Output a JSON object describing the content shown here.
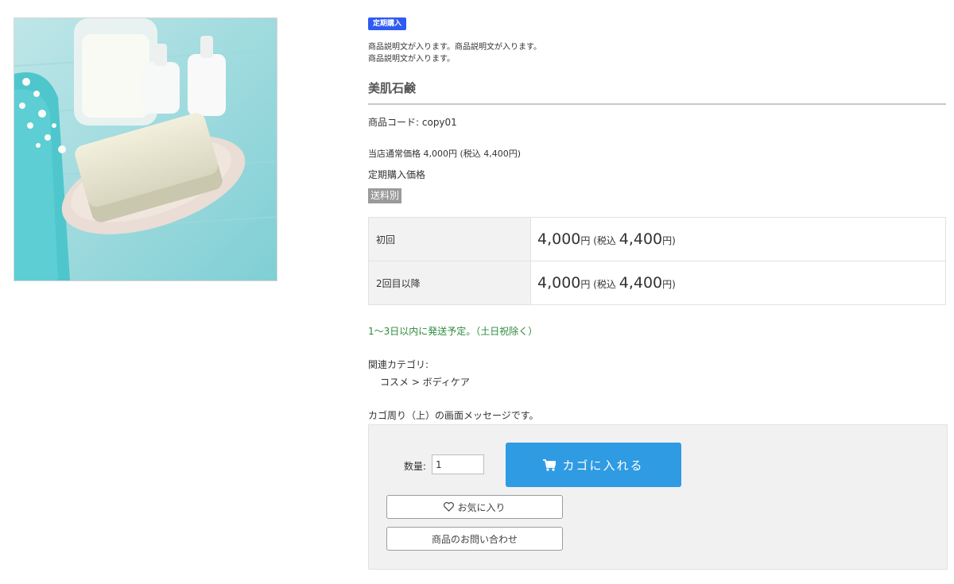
{
  "colors": {
    "badge_bg": "#2f5bf2",
    "cart_button_bg": "#2f9be3",
    "shipping_note": "#2c8a3c",
    "shipping_tag_bg": "#9a9a9a"
  },
  "product": {
    "image_alt": "soap-product-photo",
    "badge": "定期購入",
    "description_line1": "商品説明文が入ります。商品説明文が入ります。",
    "description_line2": "商品説明文が入ります。",
    "name": "美肌石鹸",
    "code_label": "商品コード:",
    "code_value": "copy01",
    "normal_price": "当店通常価格 4,000円 (税込 4,400円)",
    "subscription_label": "定期購入価格",
    "shipping_tag": "送料別"
  },
  "price_rows": [
    {
      "label": "初回",
      "price": "4,000",
      "yen": "円",
      "tax_open": " (税込 ",
      "tax_price": "4,400",
      "tax_close": "円)"
    },
    {
      "label": "2回目以降",
      "price": "4,000",
      "yen": "円",
      "tax_open": " (税込 ",
      "tax_price": "4,400",
      "tax_close": "円)"
    }
  ],
  "shipping_note": "1〜3日以内に発送予定。（土日祝除く）",
  "category": {
    "label": "関連カテゴリ:",
    "path": "コスメ > ボディケア"
  },
  "cart": {
    "message": "カゴ周り（上）の画面メッセージです。",
    "qty_label": "数量:",
    "qty_value": "1",
    "add_to_cart_label": "カゴに入れる",
    "icon": "cart-icon",
    "favorite_label": "お気に入り",
    "favorite_icon": "heart-icon",
    "inquiry_label": "商品のお問い合わせ"
  }
}
